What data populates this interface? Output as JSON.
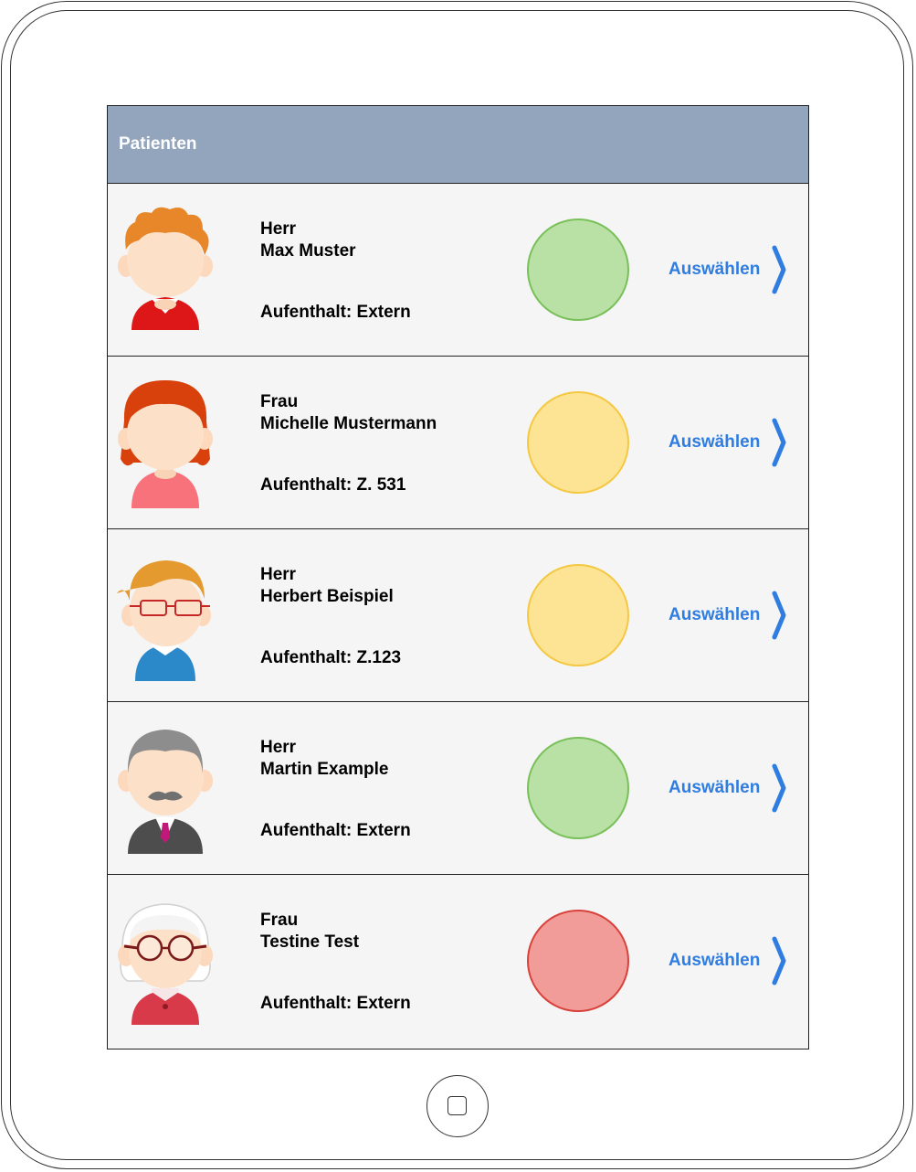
{
  "header": {
    "title": "Patienten"
  },
  "patients": [
    {
      "salutation": "Herr",
      "name": "Max Muster",
      "stay": "Aufenthalt: Extern",
      "status": "green",
      "select_label": "Auswählen",
      "avatar": "boy-curly-hair-avatar"
    },
    {
      "salutation": "Frau",
      "name": "Michelle Mustermann",
      "stay": "Aufenthalt: Z. 531",
      "status": "yellow",
      "select_label": "Auswählen",
      "avatar": "woman-red-hair-avatar"
    },
    {
      "salutation": "Herr",
      "name": "Herbert Beispiel",
      "stay": "Aufenthalt: Z.123",
      "status": "yellow",
      "select_label": "Auswählen",
      "avatar": "boy-glasses-avatar"
    },
    {
      "salutation": "Herr",
      "name": "Martin Example",
      "stay": "Aufenthalt: Extern",
      "status": "green",
      "select_label": "Auswählen",
      "avatar": "man-mustache-suit-avatar"
    },
    {
      "salutation": "Frau",
      "name": "Testine Test",
      "stay": "Aufenthalt: Extern",
      "status": "red",
      "select_label": "Auswählen",
      "avatar": "grandma-glasses-avatar"
    }
  ],
  "colors": {
    "header_bg": "#93a5bc",
    "link": "#2f7de1",
    "status_green_fill": "#b9e1a5",
    "status_green_border": "#7ac05a",
    "status_yellow_fill": "#fde495",
    "status_yellow_border": "#f4c842",
    "status_red_fill": "#f19c98",
    "status_red_border": "#d9413b"
  },
  "icons": {
    "select": "chevron-right-icon",
    "home": "home-button-icon"
  }
}
